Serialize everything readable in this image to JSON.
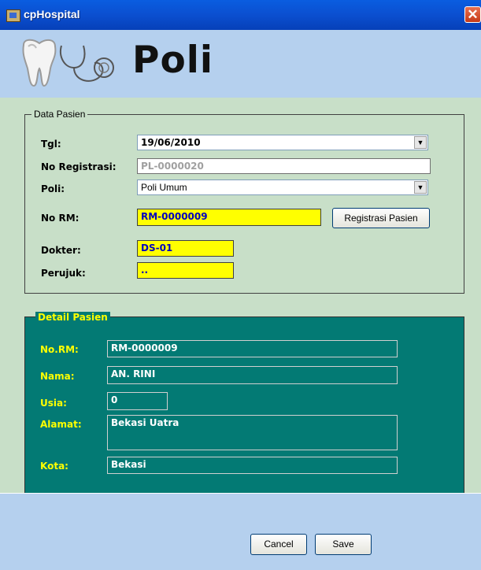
{
  "window": {
    "title": "cpHospital",
    "close_glyph": "✕"
  },
  "header": {
    "title": "Poli",
    "icons": [
      "tooth-icon",
      "stethoscope-icon"
    ]
  },
  "data_pasien": {
    "caption": "Data Pasien",
    "tgl": {
      "label": "Tgl:",
      "value": "19/06/2010"
    },
    "no_registrasi": {
      "label": "No Registrasi:",
      "value": "PL-0000020"
    },
    "poli": {
      "label": "Poli:",
      "value": "Poli Umum"
    },
    "no_rm": {
      "label": "No RM:",
      "value": "RM-0000009"
    },
    "registrasi_button": {
      "label": "Registrasi Pasien"
    },
    "dokter": {
      "label": "Dokter:",
      "value": "DS-01"
    },
    "perujuk": {
      "label": "Perujuk:",
      "value": ".."
    }
  },
  "detail_pasien": {
    "caption": "Detail Pasien",
    "no_rm": {
      "label": "No.RM:",
      "value": "RM-0000009"
    },
    "nama": {
      "label": "Nama:",
      "value": "AN. RINI"
    },
    "usia": {
      "label": "Usia:",
      "value": "0"
    },
    "alamat": {
      "label": "Alamat:",
      "value": "Bekasi Uatra"
    },
    "kota": {
      "label": "Kota:",
      "value": "Bekasi"
    }
  },
  "buttons": {
    "cancel": "Cancel",
    "save": "Save"
  },
  "colors": {
    "titlebar": "#0b4fd0",
    "banner": "#b5d0ee",
    "form_bg": "#c8dfc8",
    "detail_bg": "#037a74",
    "highlight_field": "#ffff00",
    "detail_label": "#ffff00"
  }
}
